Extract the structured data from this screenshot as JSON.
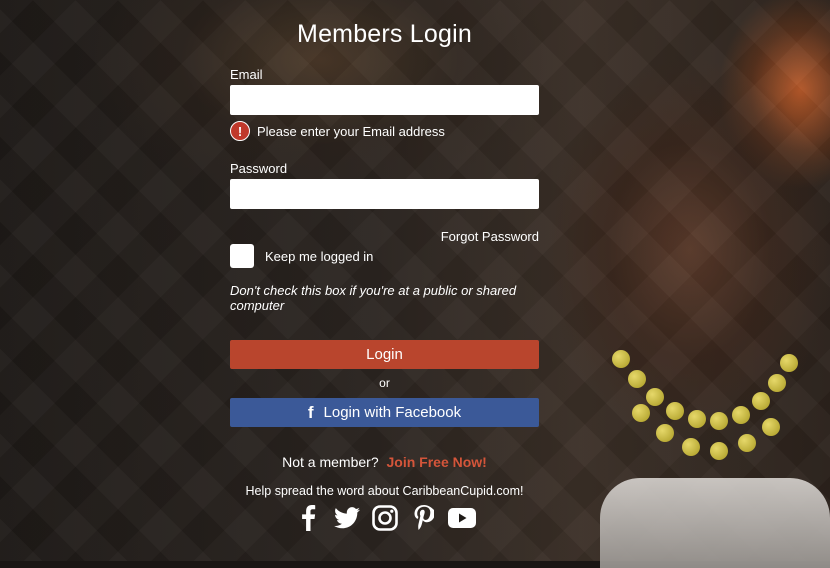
{
  "title": "Members Login",
  "email": {
    "label": "Email",
    "value": "",
    "placeholder": "",
    "error": "Please enter your Email address",
    "error_icon": "exclamation-icon"
  },
  "password": {
    "label": "Password",
    "value": "",
    "placeholder": ""
  },
  "forgot_password": "Forgot Password",
  "keep_logged_in": {
    "label": "Keep me logged in",
    "checked": false
  },
  "note": "Don't check this box if you're at a public or shared computer",
  "login_button": "Login",
  "or_text": "or",
  "facebook_button": {
    "label": "Login with Facebook",
    "icon": "facebook-icon",
    "color": "#3b5998"
  },
  "member_prompt": {
    "text": "Not a member?",
    "link": "Join Free Now!"
  },
  "spread_text": "Help spread the word about CaribbeanCupid.com!",
  "social_icons": [
    "facebook-icon",
    "twitter-icon",
    "instagram-icon",
    "pinterest-icon",
    "youtube-icon"
  ],
  "colors": {
    "login_button": "#b9452d",
    "join_link": "#d4553a",
    "error": "#c0392b"
  }
}
